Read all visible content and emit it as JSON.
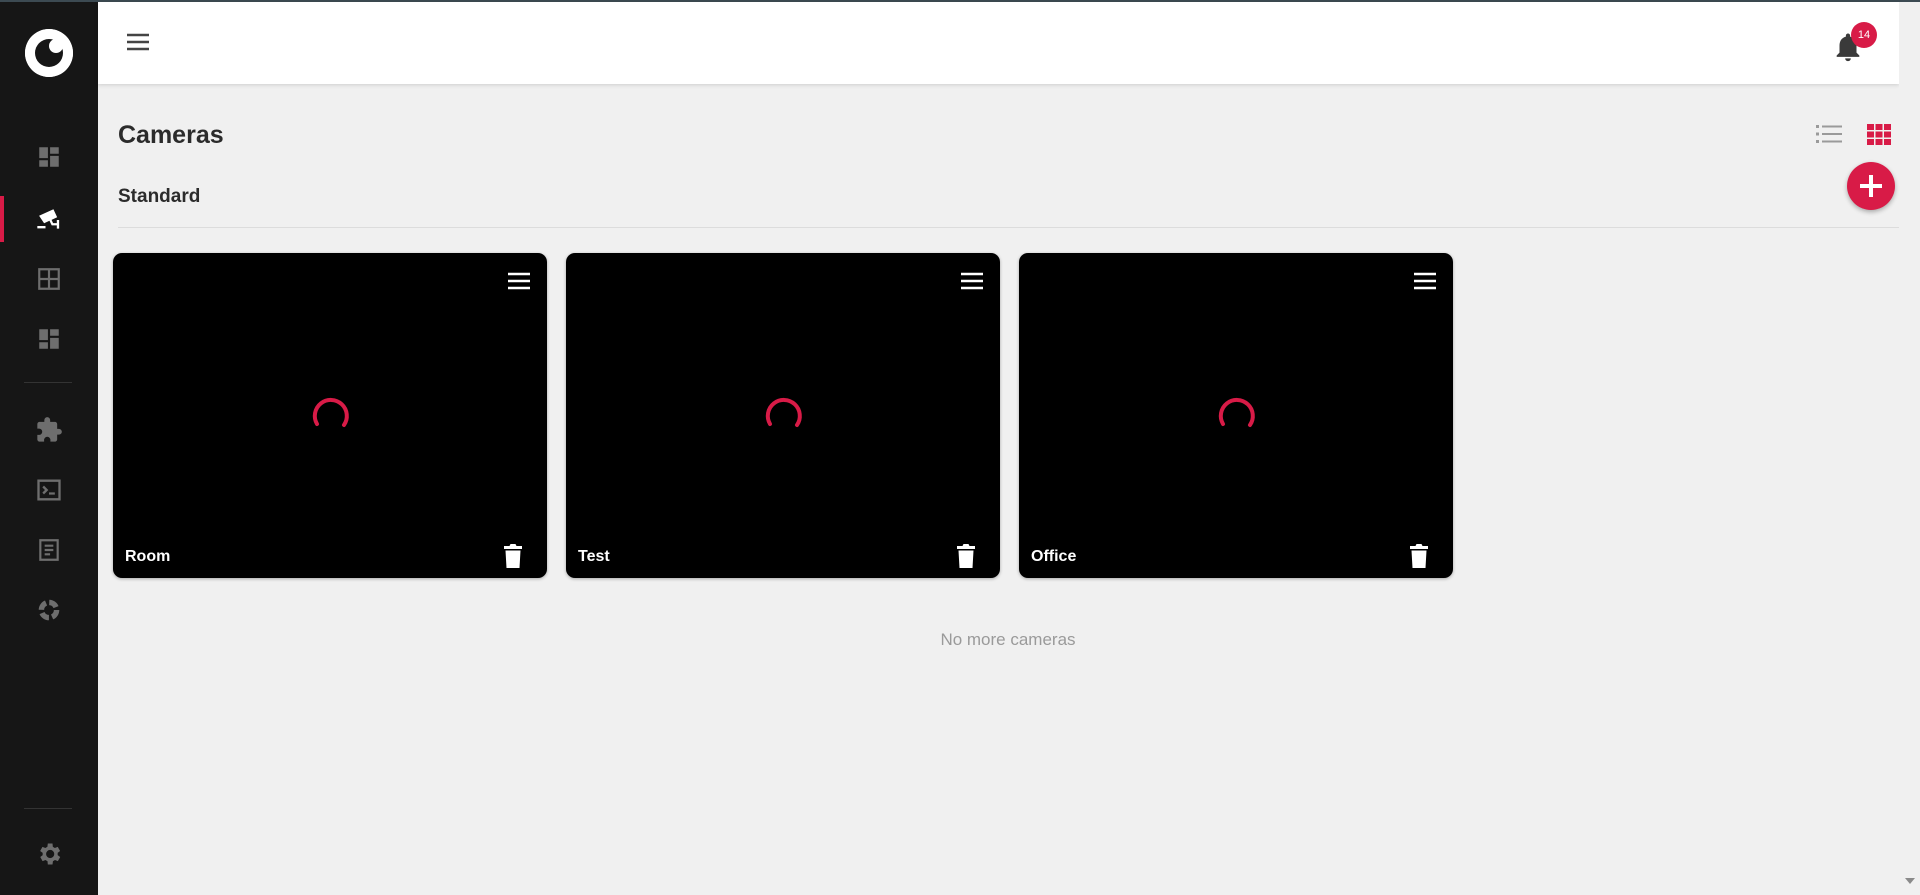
{
  "colors": {
    "accent": "#d81b47",
    "sidebar": "#161616",
    "card": "#000000"
  },
  "sidebar": {
    "logo": "camera-eye-logo",
    "items": [
      {
        "icon": "dashboard-icon",
        "active": false
      },
      {
        "icon": "cctv-camera-icon",
        "active": true
      },
      {
        "icon": "grid-view-icon",
        "active": false
      },
      {
        "icon": "dashboard-alt-icon",
        "active": false
      },
      {
        "icon": "puzzle-plugin-icon",
        "active": false
      },
      {
        "icon": "terminal-icon",
        "active": false
      },
      {
        "icon": "document-log-icon",
        "active": false
      },
      {
        "icon": "donut-chart-icon",
        "active": false
      },
      {
        "icon": "gear-icon",
        "active": false
      }
    ]
  },
  "header": {
    "notification_count": "14"
  },
  "page": {
    "title": "Cameras",
    "section": "Standard",
    "empty_message": "No more cameras"
  },
  "cameras": [
    {
      "name": "Room"
    },
    {
      "name": "Test"
    },
    {
      "name": "Office"
    }
  ]
}
